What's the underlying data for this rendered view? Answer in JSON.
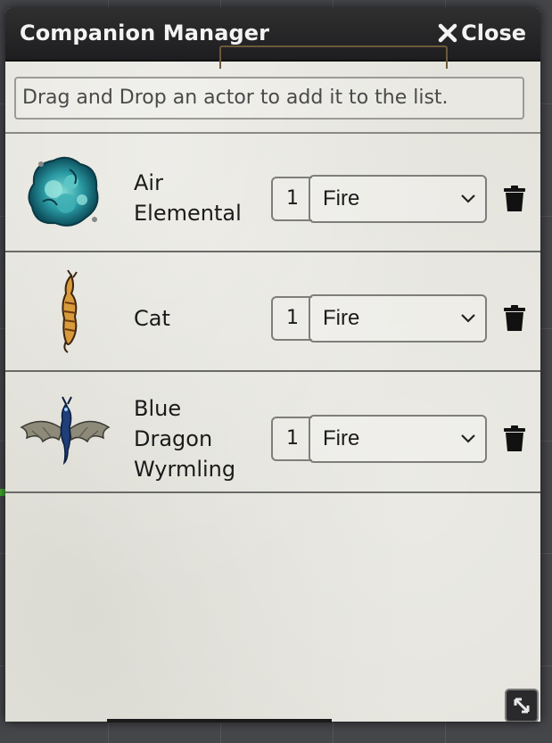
{
  "window": {
    "title": "Companion Manager",
    "close_label": "Close"
  },
  "drop_zone": {
    "text": "Drag and Drop an actor to add it to the list."
  },
  "companions": [
    {
      "name_line1": "Air",
      "name_line2": "Elemental",
      "name_line3": "",
      "quantity": "1",
      "selected_option": "Fire",
      "avatar_icon": "air-elemental-token"
    },
    {
      "name_line1": "Cat",
      "name_line2": "",
      "name_line3": "",
      "quantity": "1",
      "selected_option": "Fire",
      "avatar_icon": "cat-token"
    },
    {
      "name_line1": "Blue",
      "name_line2": "Dragon",
      "name_line3": "Wyrmling",
      "quantity": "1",
      "selected_option": "Fire",
      "avatar_icon": "blue-dragon-token"
    }
  ],
  "colors": {
    "titlebar": "#1e1e20",
    "panel": "#e4e3dc",
    "text": "#1b1b1b"
  }
}
